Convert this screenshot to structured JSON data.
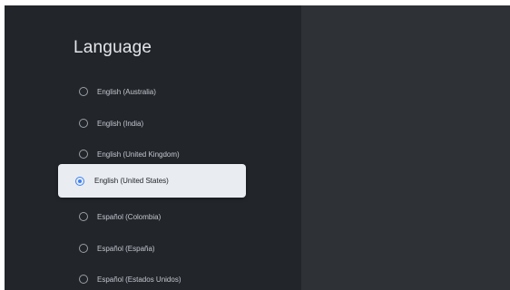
{
  "page": {
    "title": "Language"
  },
  "languages": [
    {
      "label": "English (Australia)",
      "selected": false
    },
    {
      "label": "English (India)",
      "selected": false
    },
    {
      "label": "English (United Kingdom)",
      "selected": false
    },
    {
      "label": "English (United States)",
      "selected": true
    },
    {
      "label": "Español (Colombia)",
      "selected": false
    },
    {
      "label": "Español (España)",
      "selected": false
    },
    {
      "label": "Español (Estados Unidos)",
      "selected": false
    }
  ],
  "colors": {
    "background": "#2e3136",
    "panel": "#22252a",
    "selected_background": "#e9ecf0",
    "accent": "#3b82f6"
  }
}
